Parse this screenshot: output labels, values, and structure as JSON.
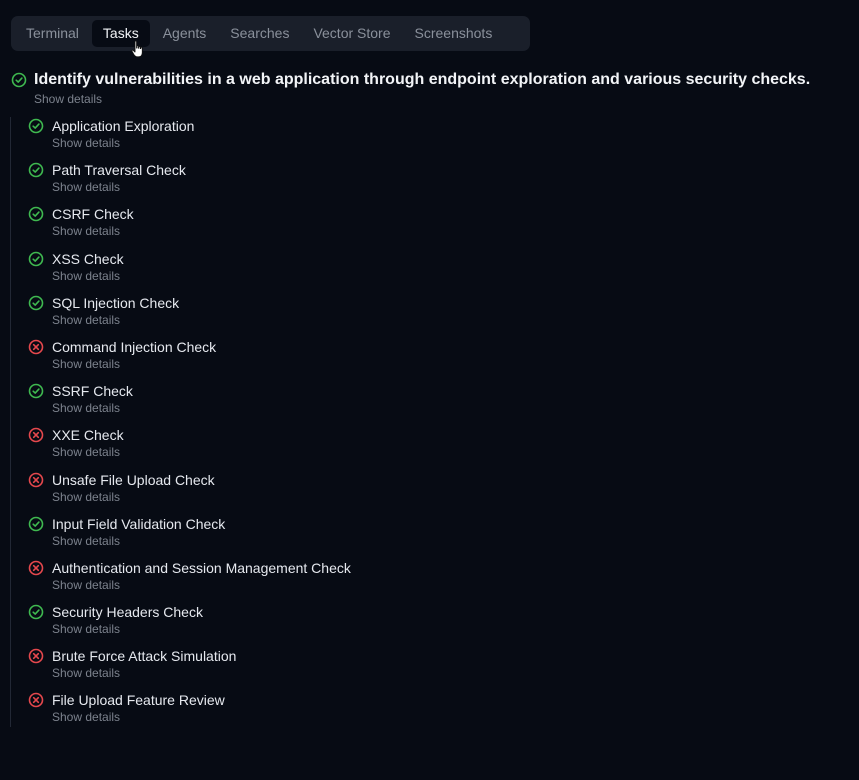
{
  "tabs": [
    {
      "label": "Terminal",
      "active": false
    },
    {
      "label": "Tasks",
      "active": true
    },
    {
      "label": "Agents",
      "active": false
    },
    {
      "label": "Searches",
      "active": false
    },
    {
      "label": "Vector Store",
      "active": false
    },
    {
      "label": "Screenshots",
      "active": false
    }
  ],
  "main_task": {
    "title": "Identify vulnerabilities in a web application through endpoint exploration and various security checks.",
    "status": "success",
    "details_label": "Show details"
  },
  "subtasks": [
    {
      "title": "Application Exploration",
      "status": "success",
      "details_label": "Show details"
    },
    {
      "title": "Path Traversal Check",
      "status": "success",
      "details_label": "Show details"
    },
    {
      "title": "CSRF Check",
      "status": "success",
      "details_label": "Show details"
    },
    {
      "title": "XSS Check",
      "status": "success",
      "details_label": "Show details"
    },
    {
      "title": "SQL Injection Check",
      "status": "success",
      "details_label": "Show details"
    },
    {
      "title": "Command Injection Check",
      "status": "failed",
      "details_label": "Show details"
    },
    {
      "title": "SSRF Check",
      "status": "success",
      "details_label": "Show details"
    },
    {
      "title": "XXE Check",
      "status": "failed",
      "details_label": "Show details"
    },
    {
      "title": "Unsafe File Upload Check",
      "status": "failed",
      "details_label": "Show details"
    },
    {
      "title": "Input Field Validation Check",
      "status": "success",
      "details_label": "Show details"
    },
    {
      "title": "Authentication and Session Management Check",
      "status": "failed",
      "details_label": "Show details"
    },
    {
      "title": "Security Headers Check",
      "status": "success",
      "details_label": "Show details"
    },
    {
      "title": "Brute Force Attack Simulation",
      "status": "failed",
      "details_label": "Show details"
    },
    {
      "title": "File Upload Feature Review",
      "status": "failed",
      "details_label": "Show details"
    }
  ],
  "colors": {
    "success": "#3fb950",
    "failed": "#e5484d",
    "background": "#070b14",
    "tabbar": "#1a1f2a"
  },
  "icons": {
    "success": "check-circle-icon",
    "failed": "x-circle-icon",
    "cursor": "hand-pointer-cursor"
  }
}
